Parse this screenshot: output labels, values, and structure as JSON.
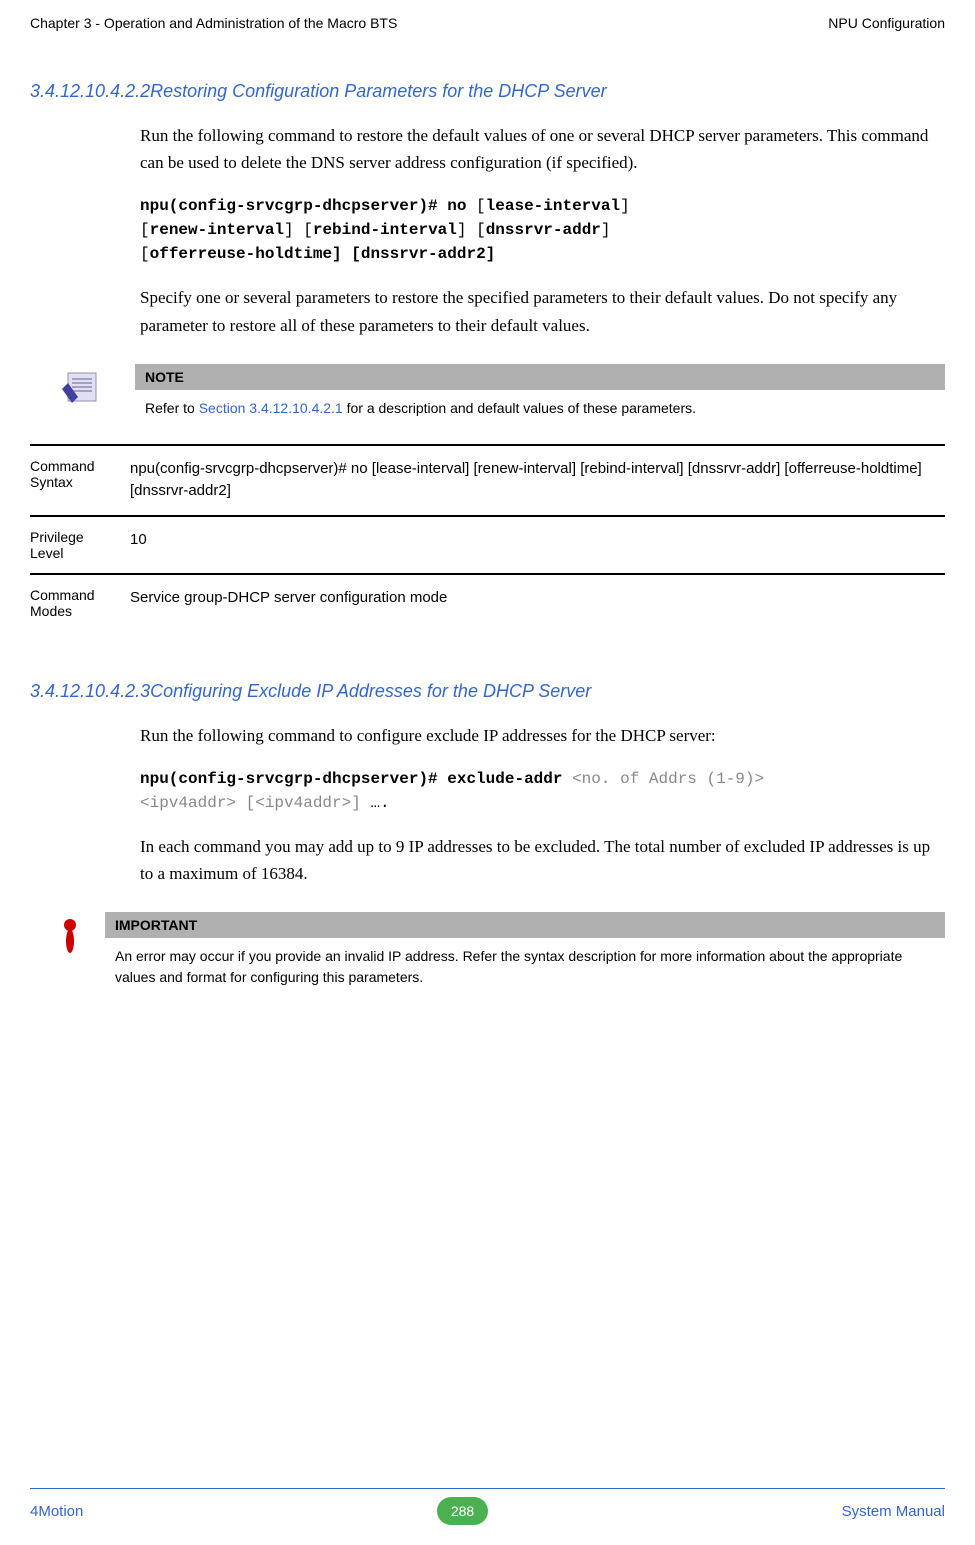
{
  "header": {
    "left": "Chapter 3 - Operation and Administration of the Macro BTS",
    "right": "NPU Configuration"
  },
  "section1": {
    "number": "3.4.12.10.4.2.2",
    "title": "Restoring Configuration Parameters for the DHCP Server",
    "para1": "Run the following command to restore the default values of one or several DHCP server parameters. This command can be used to delete the DNS server address configuration (if specified).",
    "code_prefix": "npu(config-srvcgrp-dhcpserver)# no",
    "code_p1": "lease-interval",
    "code_p2": "renew-interval",
    "code_p3": "rebind-interval",
    "code_p4": "dnssrvr-addr",
    "code_p5": "offerreuse-holdtime] [dnssrvr-addr2]",
    "para2": "Specify one or several parameters to restore the specified parameters to their default values. Do not specify any parameter to restore all of these parameters to their default values."
  },
  "note": {
    "header": "NOTE",
    "body_prefix": "Refer to ",
    "body_link": "Section 3.4.12.10.4.2.1",
    "body_suffix": " for a description and default values of these parameters."
  },
  "cmd_table": {
    "syntax_label": "Command Syntax",
    "syntax_value": "npu(config-srvcgrp-dhcpserver)# no [lease-interval] [renew-interval] [rebind-interval] [dnssrvr-addr] [offerreuse-holdtime] [dnssrvr-addr2]",
    "priv_label": "Privilege Level",
    "priv_value": "10",
    "mode_label": "Command Modes",
    "mode_value": "Service group-DHCP server configuration mode"
  },
  "section2": {
    "number": "3.4.12.10.4.2.3",
    "title": "Configuring Exclude IP Addresses for the DHCP Server",
    "para1": "Run the following command to configure exclude IP addresses for the DHCP server:",
    "code_bold": "npu(config-srvcgrp-dhcpserver)# exclude-addr",
    "code_gray1": "<no. of Addrs (1-9)>",
    "code_gray2": "<ipv4addr> [<ipv4addr>]",
    "code_suffix": " ….",
    "para2": "In each command you may add up to 9 IP addresses to be excluded. The total number of excluded IP addresses is up to a maximum of 16384."
  },
  "important": {
    "header": "IMPORTANT",
    "body": "An error may occur if you provide an invalid IP address. Refer the syntax description for more information about the appropriate values and format for configuring this parameters."
  },
  "footer": {
    "left": "4Motion",
    "page": "288",
    "right": "System Manual"
  }
}
